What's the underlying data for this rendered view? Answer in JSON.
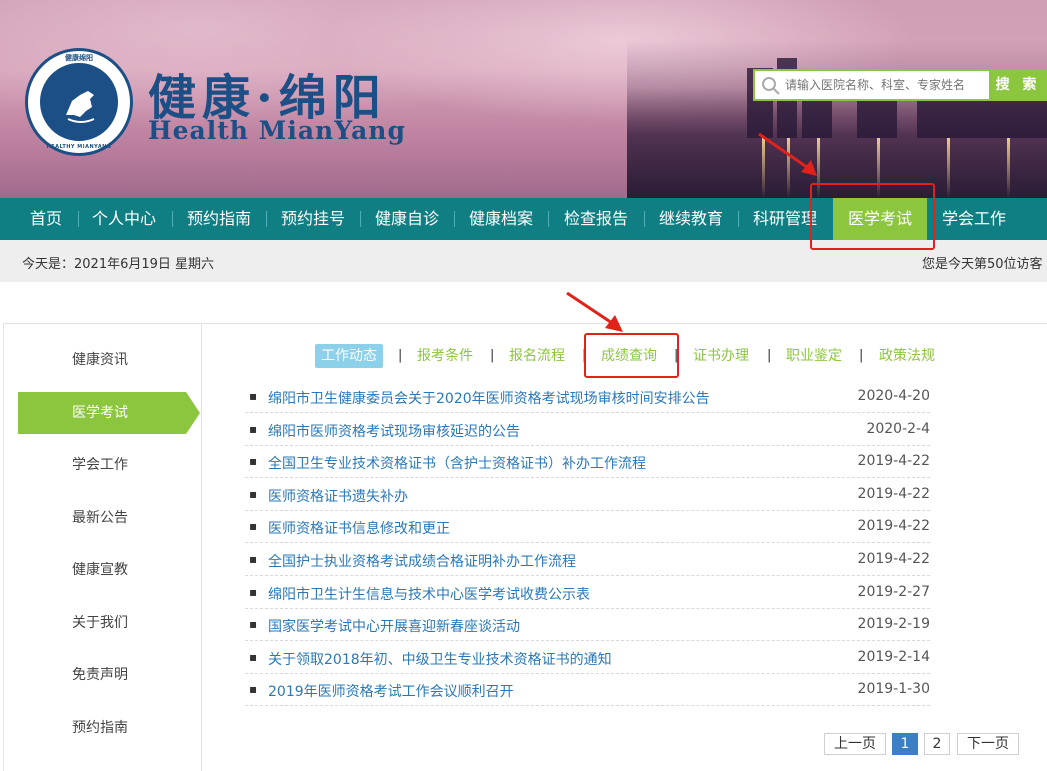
{
  "header": {
    "logo_top_text": "健康绵阳",
    "logo_bottom_text": "HEALTHY MIANYANG",
    "title_cn": "健康·绵阳",
    "title_en": "Health MianYang",
    "search_placeholder": "请输入医院名称、科室、专家姓名",
    "search_button": "搜 索"
  },
  "nav": {
    "items": [
      {
        "label": "首页"
      },
      {
        "label": "个人中心"
      },
      {
        "label": "预约指南"
      },
      {
        "label": "预约挂号"
      },
      {
        "label": "健康自诊"
      },
      {
        "label": "健康档案"
      },
      {
        "label": "检查报告"
      },
      {
        "label": "继续教育"
      },
      {
        "label": "科研管理"
      },
      {
        "label": "医学考试",
        "active": true
      },
      {
        "label": "学会工作"
      }
    ]
  },
  "datebar": {
    "date": "今天是：2021年6月19日 星期六",
    "visitor": "您是今天第50位访客"
  },
  "sidebar": {
    "items": [
      {
        "label": "健康资讯"
      },
      {
        "label": "医学考试",
        "active": true
      },
      {
        "label": "学会工作"
      },
      {
        "label": "最新公告"
      },
      {
        "label": "健康宣教"
      },
      {
        "label": "关于我们"
      },
      {
        "label": "免责声明"
      },
      {
        "label": "预约指南"
      }
    ]
  },
  "tabs": {
    "items": [
      {
        "label": "工作动态",
        "active": true
      },
      {
        "label": "报考条件"
      },
      {
        "label": "报名流程"
      },
      {
        "label": "成绩查询"
      },
      {
        "label": "证书办理"
      },
      {
        "label": "职业鉴定"
      },
      {
        "label": "政策法规"
      }
    ],
    "separator": "|"
  },
  "news": {
    "bullet": "▪",
    "items": [
      {
        "title": "绵阳市卫生健康委员会关于2020年医师资格考试现场审核时间安排公告",
        "date": "2020-4-20"
      },
      {
        "title": "绵阳市医师资格考试现场审核延迟的公告",
        "date": "2020-2-4"
      },
      {
        "title": "全国卫生专业技术资格证书（含护士资格证书）补办工作流程",
        "date": "2019-4-22"
      },
      {
        "title": "医师资格证书遗失补办",
        "date": "2019-4-22"
      },
      {
        "title": "医师资格证书信息修改和更正",
        "date": "2019-4-22"
      },
      {
        "title": "全国护士执业资格考试成绩合格证明补办工作流程",
        "date": "2019-4-22"
      },
      {
        "title": "绵阳市卫生计生信息与技术中心医学考试收费公示表",
        "date": "2019-2-27"
      },
      {
        "title": "国家医学考试中心开展喜迎新春座谈活动",
        "date": "2019-2-19"
      },
      {
        "title": "关于领取2018年初、中级卫生专业技术资格证书的通知",
        "date": "2019-2-14"
      },
      {
        "title": "2019年医师资格考试工作会议顺利召开",
        "date": "2019-1-30"
      }
    ]
  },
  "pager": {
    "prev": "上一页",
    "pages": [
      "1",
      "2"
    ],
    "current": "1",
    "next": "下一页"
  },
  "colors": {
    "nav_bg": "#0f7f83",
    "accent_green": "#8cc63f",
    "link_blue": "#2a78b8",
    "annotation_red": "#e0221b"
  }
}
